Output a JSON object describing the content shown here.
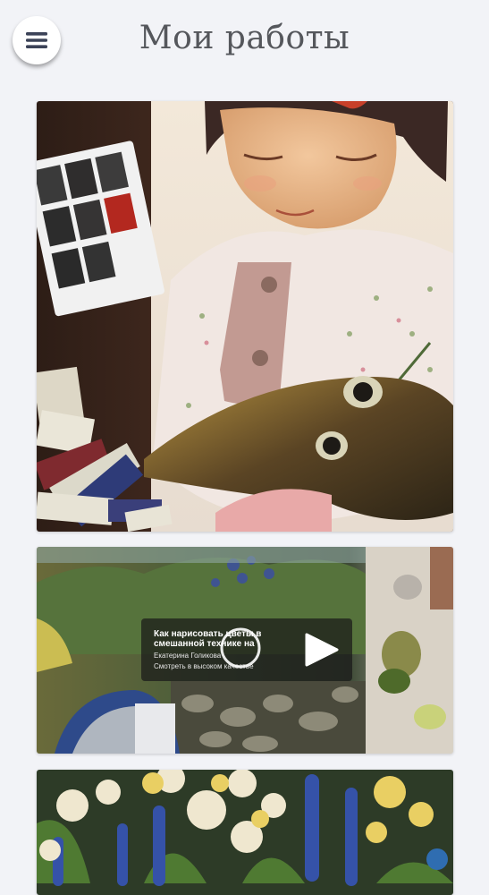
{
  "header": {
    "title": "Мои работы",
    "menu_icon": "hamburger-menu-icon"
  },
  "gallery": {
    "items": [
      {
        "kind": "image",
        "subject": "Watercolor painting of a girl holding a kitten, paint box and paint tubes beside it"
      },
      {
        "kind": "video",
        "video": {
          "title": "Как нарисовать цветы в смешанной технике на",
          "author": "Екатерина Голикова",
          "quality_link": "Смотреть в высоком качестве",
          "play_icon": "play-icon",
          "loading_icon": "loading-ring-icon"
        }
      },
      {
        "kind": "image",
        "subject": "Impasto painting of white and yellow roses with blue lupins"
      }
    ]
  },
  "colors": {
    "background": "#f2f3f7",
    "title": "#55575c",
    "menu_button": "#ffffff",
    "menu_icon": "#3b4257"
  }
}
